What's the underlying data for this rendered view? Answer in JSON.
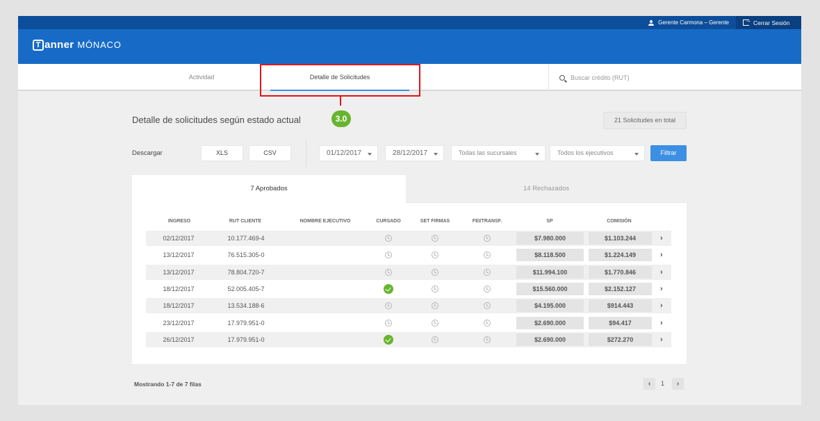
{
  "header": {
    "user_label": "Gerente Carmona – Gerente",
    "logout_label": "Cerrar Sesión"
  },
  "brand": {
    "icon_letter": "T",
    "name": "anner",
    "sub": "MÓNACO"
  },
  "nav": {
    "tabs": [
      {
        "label": "Actividad"
      },
      {
        "label": "Detalle de Solicitudes"
      }
    ],
    "search_placeholder": "Buscar crédito (RUT)"
  },
  "annotation": {
    "step": "3.0",
    "color": "#e0141c"
  },
  "page": {
    "title": "Detalle de solicitudes según estado actual",
    "total": "21 Solicitudes en total"
  },
  "filters": {
    "download_label": "Descargar",
    "xls": "XLS",
    "csv": "CSV",
    "date_from": "01/12/2017",
    "date_to": "28/12/2017",
    "branch": "Todas las sucursales",
    "executive": "Todos los ejecutivos",
    "filter_button": "Filtrar"
  },
  "status_tabs": [
    {
      "label": "7 Aprobados"
    },
    {
      "label": "14 Rechazados"
    }
  ],
  "table": {
    "columns": [
      "INGRESO",
      "RUT CLIENTE",
      "NOMBRE EJECUTIVO",
      "CURSADO",
      "SET FIRMAS",
      "FEI/TRANSF.",
      "SP",
      "COMISIÓN"
    ],
    "rows": [
      {
        "ingreso": "02/12/2017",
        "rut": "10.177.469-4",
        "cursado": "pending",
        "sp": "$7.980.000",
        "comision": "$1.103.244"
      },
      {
        "ingreso": "13/12/2017",
        "rut": "76.515.305-0",
        "cursado": "pending",
        "sp": "$8.118.500",
        "comision": "$1.224.149"
      },
      {
        "ingreso": "13/12/2017",
        "rut": "78.804.720-7",
        "cursado": "pending",
        "sp": "$11.994.100",
        "comision": "$1.770.846"
      },
      {
        "ingreso": "18/12/2017",
        "rut": "52.005.405-7",
        "cursado": "done",
        "sp": "$15.560.000",
        "comision": "$2.152.127"
      },
      {
        "ingreso": "18/12/2017",
        "rut": "13.534.188-6",
        "cursado": "pending",
        "sp": "$4.195.000",
        "comision": "$914.443"
      },
      {
        "ingreso": "23/12/2017",
        "rut": "17.979.951-0",
        "cursado": "pending",
        "sp": "$2.690.000",
        "comision": "$94.417"
      },
      {
        "ingreso": "26/12/2017",
        "rut": "17.979.951-0",
        "cursado": "done",
        "sp": "$2.690.000",
        "comision": "$272.270"
      }
    ],
    "row_chevron": "›"
  },
  "footer": {
    "showing": "Mostrando 1-7 de 7 filas",
    "page": "1",
    "prev": "‹",
    "next": "›"
  },
  "colors": {
    "top_bar": "#0d4e9b",
    "brand_bar": "#176bc7",
    "accent": "#3c8fe3",
    "success": "#67b52e"
  }
}
